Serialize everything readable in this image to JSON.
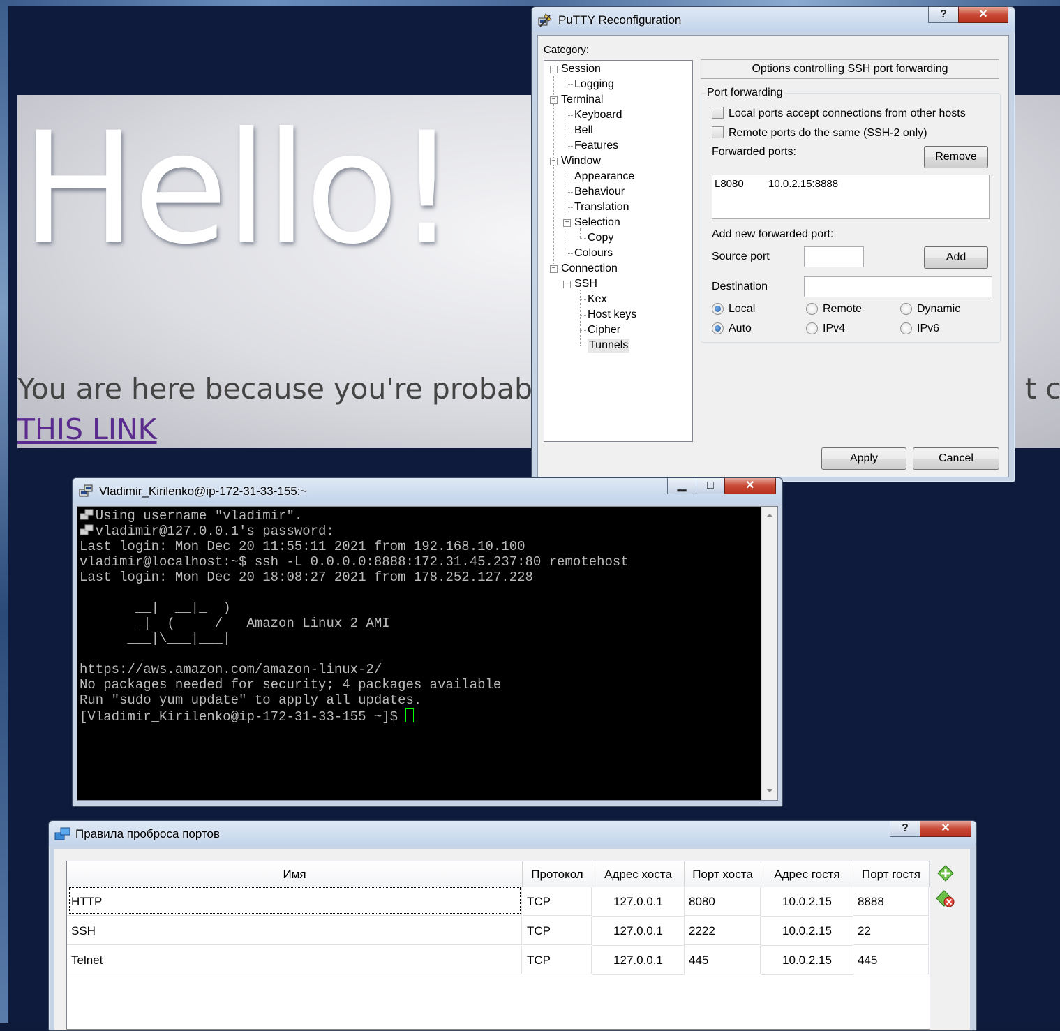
{
  "browser": {
    "hero_title": "Hello!",
    "hero_text": "You are here because you're probably",
    "hero_text_tail": "t cas",
    "link_text": "THIS LINK"
  },
  "putty_config": {
    "title": "PuTTY Reconfiguration",
    "help_button": "?",
    "close_button": "✕",
    "category_label": "Category:",
    "tree": [
      {
        "label": "Session",
        "level": 0,
        "expander": "−"
      },
      {
        "label": "Logging",
        "level": 1
      },
      {
        "label": "Terminal",
        "level": 0,
        "expander": "−"
      },
      {
        "label": "Keyboard",
        "level": 1
      },
      {
        "label": "Bell",
        "level": 1
      },
      {
        "label": "Features",
        "level": 1
      },
      {
        "label": "Window",
        "level": 0,
        "expander": "−"
      },
      {
        "label": "Appearance",
        "level": 1
      },
      {
        "label": "Behaviour",
        "level": 1
      },
      {
        "label": "Translation",
        "level": 1
      },
      {
        "label": "Selection",
        "level": 1,
        "expander": "−"
      },
      {
        "label": "Copy",
        "level": 2
      },
      {
        "label": "Colours",
        "level": 1
      },
      {
        "label": "Connection",
        "level": 0,
        "expander": "−"
      },
      {
        "label": "SSH",
        "level": 1,
        "expander": "−"
      },
      {
        "label": "Kex",
        "level": 2
      },
      {
        "label": "Host keys",
        "level": 2
      },
      {
        "label": "Cipher",
        "level": 2
      },
      {
        "label": "Tunnels",
        "level": 2,
        "selected": true
      }
    ],
    "header": "Options controlling SSH port forwarding",
    "group_label": "Port forwarding",
    "chk_local": "Local ports accept connections from other hosts",
    "chk_remote": "Remote ports do the same (SSH-2 only)",
    "forwarded_label": "Forwarded ports:",
    "remove_button": "Remove",
    "forwarded_list": [
      {
        "name": "L8080",
        "dest": "10.0.2.15:8888"
      }
    ],
    "add_new_label": "Add new forwarded port:",
    "source_port_label": "Source port",
    "source_port_value": "",
    "add_button": "Add",
    "destination_label": "Destination",
    "destination_value": "",
    "radio_local": "Local",
    "radio_remote": "Remote",
    "radio_dynamic": "Dynamic",
    "radio_auto": "Auto",
    "radio_ipv4": "IPv4",
    "radio_ipv6": "IPv6",
    "selected_direction": "Local",
    "selected_ip": "Auto",
    "apply_button": "Apply",
    "cancel_button": "Cancel"
  },
  "terminal": {
    "title": "Vladimir_Kirilenko@ip-172-31-33-155:~",
    "minimize": "▁",
    "maximize": "□",
    "close": "✕",
    "lines": [
      "  Using username \"vladimir\".",
      "  vladimir@127.0.0.1's password:",
      "Last login: Mon Dec 20 11:55:11 2021 from 192.168.10.100",
      "vladimir@localhost:~$ ssh -L 0.0.0.0:8888:172.31.45.237:80 remotehost",
      "Last login: Mon Dec 20 18:08:27 2021 from 178.252.127.228",
      "",
      "       __|  __|_  )",
      "       _|  (     /   Amazon Linux 2 AMI",
      "      ___|\\___|___|",
      "",
      "https://aws.amazon.com/amazon-linux-2/",
      "No packages needed for security; 4 packages available",
      "Run \"sudo yum update\" to apply all updates.",
      "[Vladimir_Kirilenko@ip-172-31-33-155 ~]$ "
    ],
    "colors": {
      "bg": "#000000",
      "fg": "#bbbbbb",
      "cursor": "#00ff00"
    }
  },
  "vbox_rules": {
    "title": "Правила проброса портов",
    "help_button": "?",
    "close_button": "✕",
    "columns": [
      "Имя",
      "Протокол",
      "Адрес хоста",
      "Порт хоста",
      "Адрес гостя",
      "Порт гостя"
    ],
    "rows": [
      [
        "HTTP",
        "TCP",
        "127.0.0.1",
        "8080",
        "10.0.2.15",
        "8888"
      ],
      [
        "SSH",
        "TCP",
        "127.0.0.1",
        "2222",
        "10.0.2.15",
        "22"
      ],
      [
        "Telnet",
        "TCP",
        "127.0.0.1",
        "445",
        "10.0.2.15",
        "445"
      ]
    ],
    "icons": [
      "add-rule-icon",
      "remove-rule-icon"
    ]
  }
}
